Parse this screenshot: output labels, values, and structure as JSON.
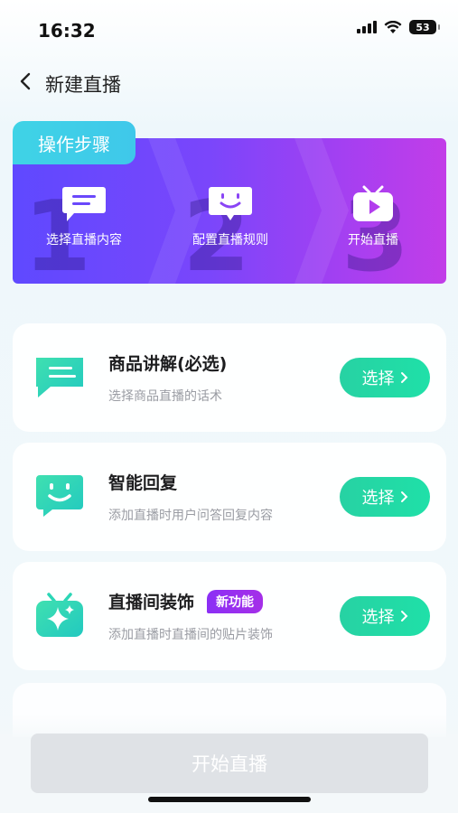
{
  "status_bar": {
    "time": "16:32",
    "battery": "53"
  },
  "nav": {
    "title": "新建直播"
  },
  "steps": {
    "tag": "操作步骤",
    "items": [
      {
        "number": "1",
        "label": "选择直播内容",
        "icon": "chat-bubble-icon"
      },
      {
        "number": "2",
        "label": "配置直播规则",
        "icon": "smile-bubble-icon"
      },
      {
        "number": "3",
        "label": "开始直播",
        "icon": "tv-play-icon"
      }
    ]
  },
  "cards": [
    {
      "title": "商品讲解(必选)",
      "desc": "选择商品直播的话术",
      "button": "选择",
      "icon": "chat-lines-icon"
    },
    {
      "title": "智能回复",
      "desc": "添加直播时用户问答回复内容",
      "button": "选择",
      "icon": "smile-chat-icon"
    },
    {
      "title": "直播间装饰",
      "badge": "新功能",
      "desc": "添加直播时直播间的贴片装饰",
      "button": "选择",
      "icon": "sparkle-tv-icon"
    }
  ],
  "bottom": {
    "start_label": "开始直播"
  },
  "colors": {
    "accent_green": "#27d2a3",
    "banner_start": "#5f49ff",
    "banner_end": "#c23de8",
    "badge": "#9a2ff0"
  }
}
